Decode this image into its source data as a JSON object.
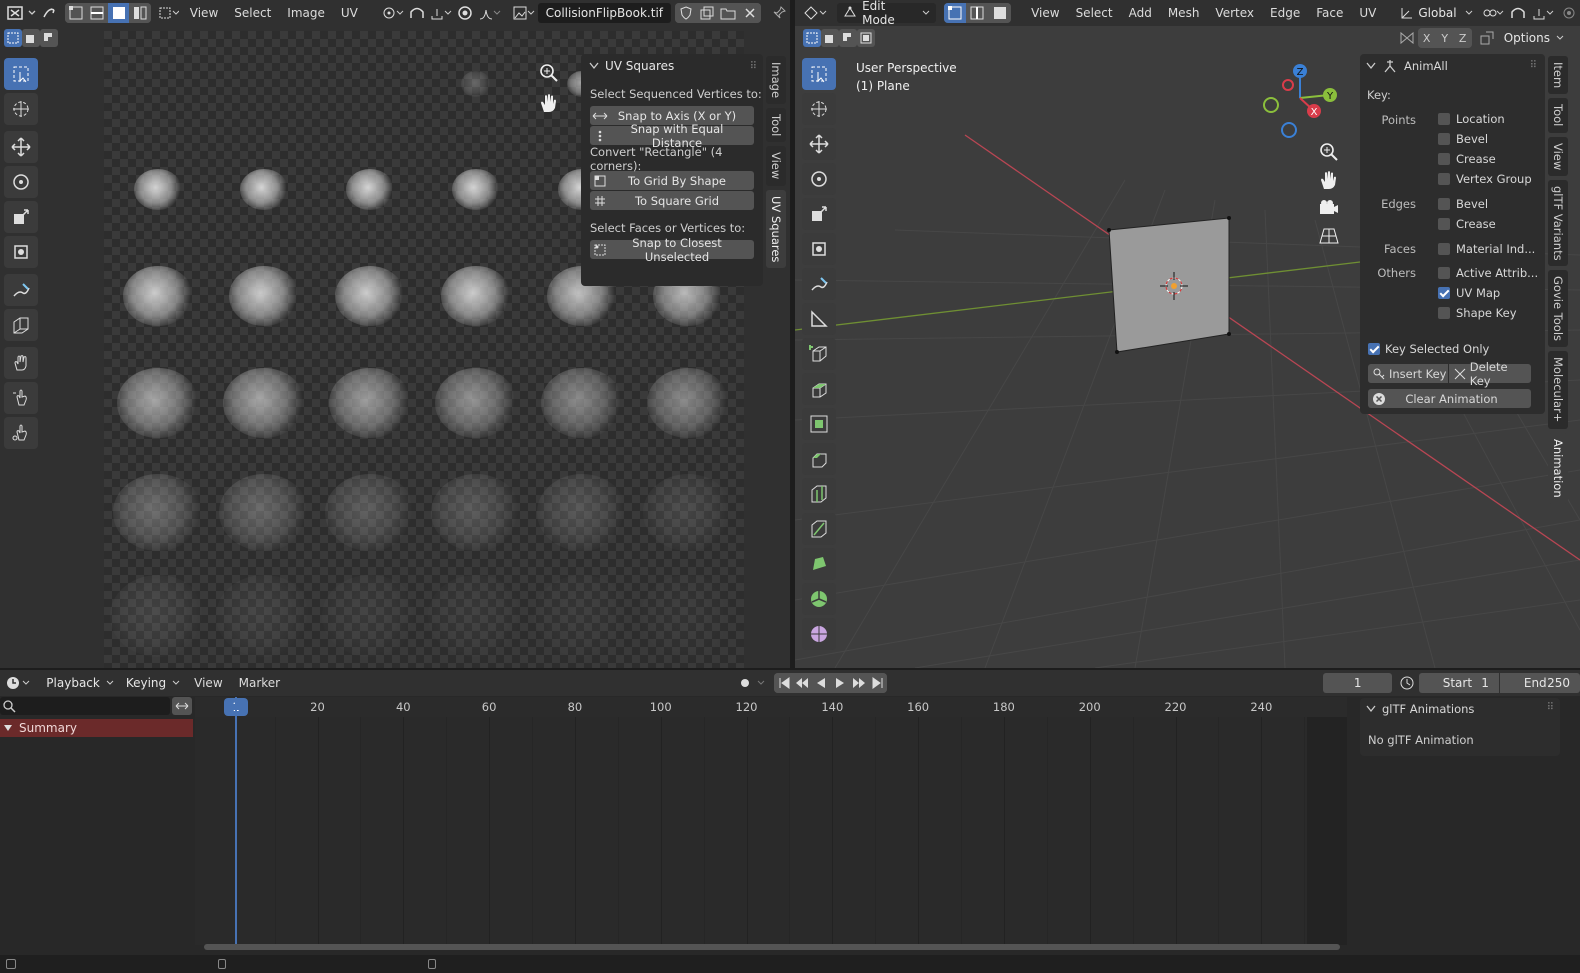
{
  "uv_editor": {
    "menus": [
      "View",
      "Select",
      "Image",
      "UV"
    ],
    "image_name": "CollisionFlipBook.tif",
    "sidebar_tabs": [
      "Image",
      "Tool",
      "View",
      "UV Squares"
    ],
    "panel": {
      "title": "UV Squares",
      "label1": "Select Sequenced Vertices to:",
      "btn_snap_axis": "Snap to Axis (X or Y)",
      "btn_snap_equal": "Snap with Equal Distance",
      "label2": "Convert \"Rectangle\" (4 corners):",
      "btn_grid_shape": "To Grid By Shape",
      "btn_square_grid": "To Square Grid",
      "label3": "Select Faces or Vertices to:",
      "btn_snap_closest": "Snap to Closest Unselected"
    }
  },
  "viewport": {
    "mode": "Edit Mode",
    "menus": [
      "View",
      "Select",
      "Add",
      "Mesh",
      "Vertex",
      "Edge",
      "Face",
      "UV"
    ],
    "orientation": "Global",
    "options_label": "Options",
    "axis_x": "X",
    "axis_y": "Y",
    "axis_z": "Z",
    "overlay_line1": "User Perspective",
    "overlay_line2": "(1) Plane",
    "sidebar_tabs": [
      "Item",
      "Tool",
      "View",
      "glTF Variants",
      "Govie Tools",
      "Molecular+",
      "Animation"
    ],
    "animall": {
      "title": "AnimAll",
      "key_label": "Key:",
      "points_label": "Points",
      "points": [
        {
          "label": "Location",
          "checked": false
        },
        {
          "label": "Bevel",
          "checked": false
        },
        {
          "label": "Crease",
          "checked": false
        },
        {
          "label": "Vertex Group",
          "checked": false
        }
      ],
      "edges_label": "Edges",
      "edges": [
        {
          "label": "Bevel",
          "checked": false
        },
        {
          "label": "Crease",
          "checked": false
        }
      ],
      "faces_label": "Faces",
      "faces": [
        {
          "label": "Material Ind...",
          "checked": false
        }
      ],
      "others_label": "Others",
      "others": [
        {
          "label": "Active Attrib...",
          "checked": false
        },
        {
          "label": "UV Map",
          "checked": true
        },
        {
          "label": "Shape Key",
          "checked": false
        }
      ],
      "key_selected_only": "Key Selected Only",
      "insert_key": "Insert Key",
      "delete_key": "Delete Key",
      "clear_animation": "Clear Animation"
    }
  },
  "timeline": {
    "menus": [
      "Playback",
      "Keying",
      "View",
      "Marker"
    ],
    "current_frame": "1",
    "start_label": "Start",
    "start_value": "1",
    "end_label": "End",
    "end_value": "250",
    "ruler_marks": [
      "20",
      "40",
      "60",
      "80",
      "100",
      "120",
      "140",
      "160",
      "180",
      "200",
      "220",
      "240"
    ],
    "playhead_label": "1",
    "summary_label": "Summary",
    "gltf_title": "glTF Animations",
    "gltf_empty": "No glTF Animation"
  },
  "colors": {
    "accent": "#4772b3",
    "x_axis": "#d93c4a",
    "y_axis": "#8bbf3c",
    "z_axis": "#3a80d6",
    "summary_bg": "#6b2a2a"
  }
}
